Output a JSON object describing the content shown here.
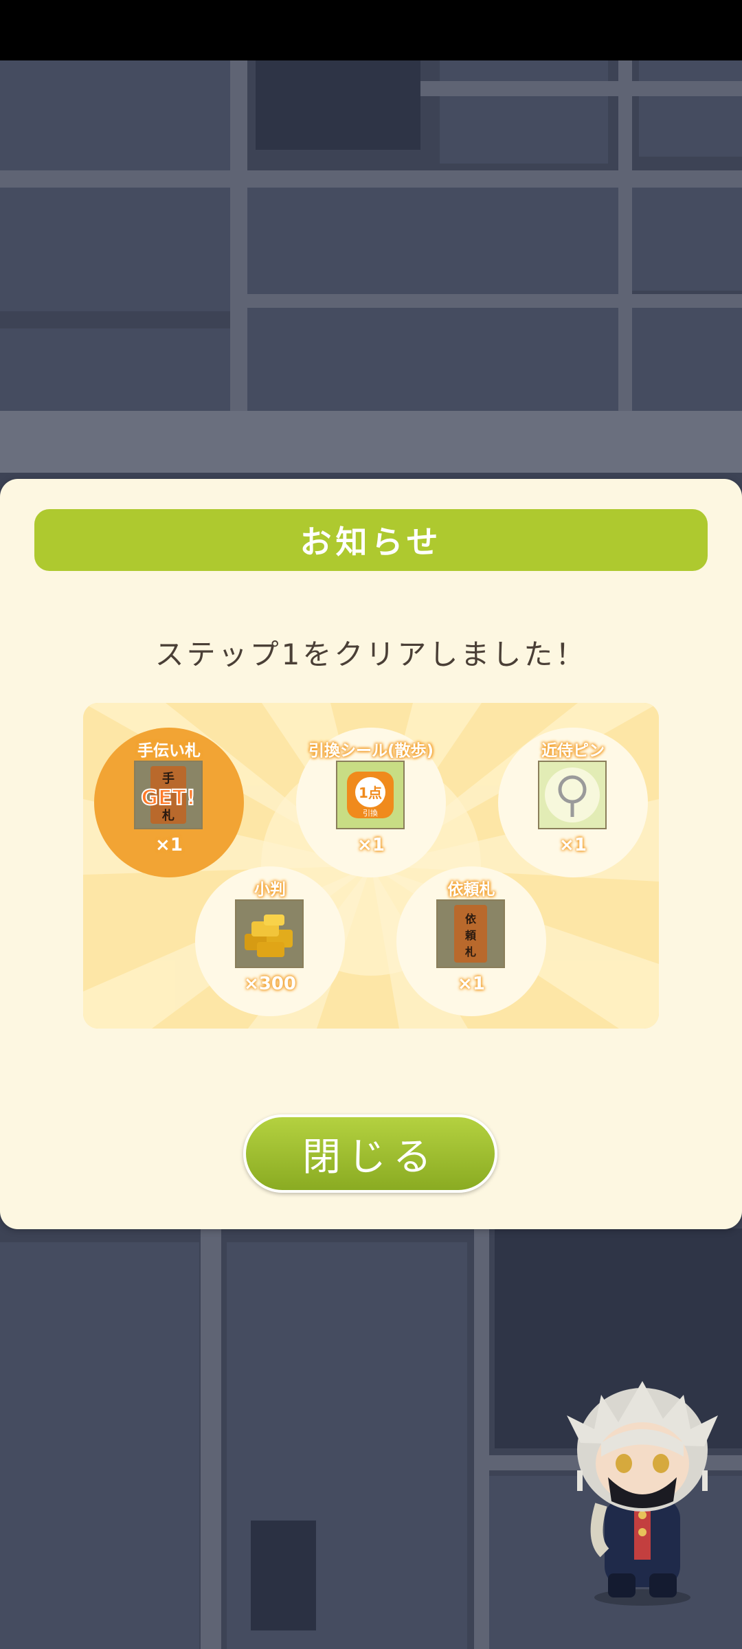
{
  "dialog": {
    "title": "お知らせ",
    "message": "ステップ1をクリアしました！",
    "close_label": "閉じる"
  },
  "rewards": [
    {
      "name": "手伝い札",
      "quantity": "×1",
      "icon": "helper-tag-icon",
      "badge": "GET!",
      "tag_chars": "手 札",
      "highlighted": true
    },
    {
      "name": "引換シール(散歩)",
      "quantity": "×1",
      "icon": "exchange-sticker-icon",
      "sticker_text": "1点",
      "sticker_sub": "引換"
    },
    {
      "name": "近侍ピン",
      "quantity": "×1",
      "icon": "pin-icon"
    },
    {
      "name": "小判",
      "quantity": "×300",
      "icon": "gold-coins-icon"
    },
    {
      "name": "依頼札",
      "quantity": "×1",
      "icon": "request-tag-icon",
      "tag_chars": "依 頼 札"
    }
  ],
  "colors": {
    "title_bar": "#aec92f",
    "dialog_bg": "#fdf7e1",
    "panel_bg": "#fde9b0",
    "highlight": "#f2a434",
    "close_button": "#9bbc2b"
  }
}
